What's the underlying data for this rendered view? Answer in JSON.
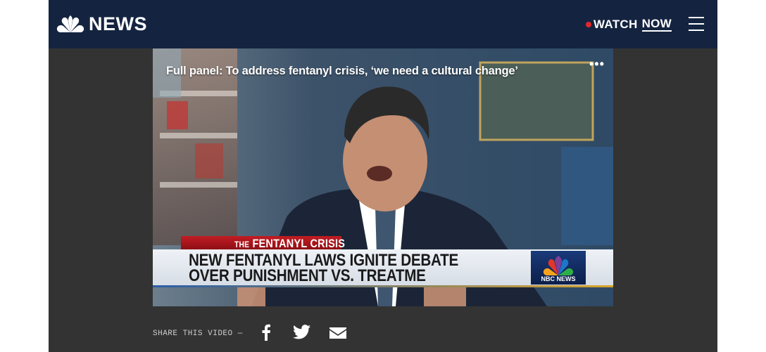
{
  "header": {
    "logo_text": "NEWS",
    "watch_label": "WATCH",
    "now_label": "NOW",
    "logo_icon": "peacock-icon",
    "menu_icon": "hamburger-menu-icon",
    "live_color": "#e3262d",
    "bg_color": "#142440"
  },
  "video": {
    "title": "Full panel: To address fentanyl crisis, ‘we need a cultural change’",
    "more_label": "•••",
    "lower_third": {
      "tag_prefix": "THE",
      "tag": "FENTANYL CRISIS",
      "headline_line1": "NEW FENTANYL LAWS IGNITE DEBATE",
      "headline_line2": "OVER PUNISHMENT VS. TREATME",
      "network_label": "NBC NEWS"
    }
  },
  "share": {
    "label": "SHARE THIS VIDEO —",
    "icons": [
      "facebook-icon",
      "twitter-icon",
      "email-icon"
    ]
  }
}
